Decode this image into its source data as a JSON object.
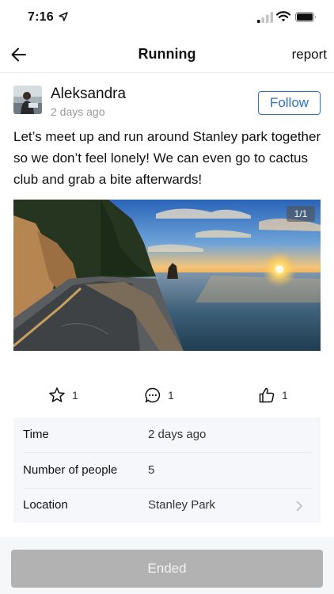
{
  "status_bar": {
    "time": "7:16",
    "icons": [
      "location-arrow-icon",
      "cellular-signal-icon",
      "wifi-icon",
      "battery-icon"
    ]
  },
  "nav": {
    "back_icon": "arrow-left-icon",
    "title": "Running",
    "report_label": "report"
  },
  "post": {
    "author_name": "Aleksandra",
    "time_ago": "2 days ago",
    "follow_label": "Follow",
    "text": "Let’s meet up and run around Stanley park together so we don’t feel lonely! We can even go to cactus club and grab a bite afterwards!",
    "photo_counter": "1/1"
  },
  "actions": {
    "favorite": {
      "icon": "star-icon",
      "count": "1"
    },
    "comment": {
      "icon": "comment-bubble-icon",
      "count": "1"
    },
    "like": {
      "icon": "thumbs-up-icon",
      "count": "1"
    }
  },
  "details": [
    {
      "label": "Time",
      "value": "2 days ago"
    },
    {
      "label": "Number of people",
      "value": "5"
    },
    {
      "label": "Location",
      "value": "Stanley Park",
      "icon": "chevron-right-icon"
    }
  ],
  "footer": {
    "button_label": "Ended"
  },
  "colors": {
    "accent": "#2b73c8",
    "disabled_button": "#b2b2b2",
    "card_background": "#f5f7fa"
  }
}
